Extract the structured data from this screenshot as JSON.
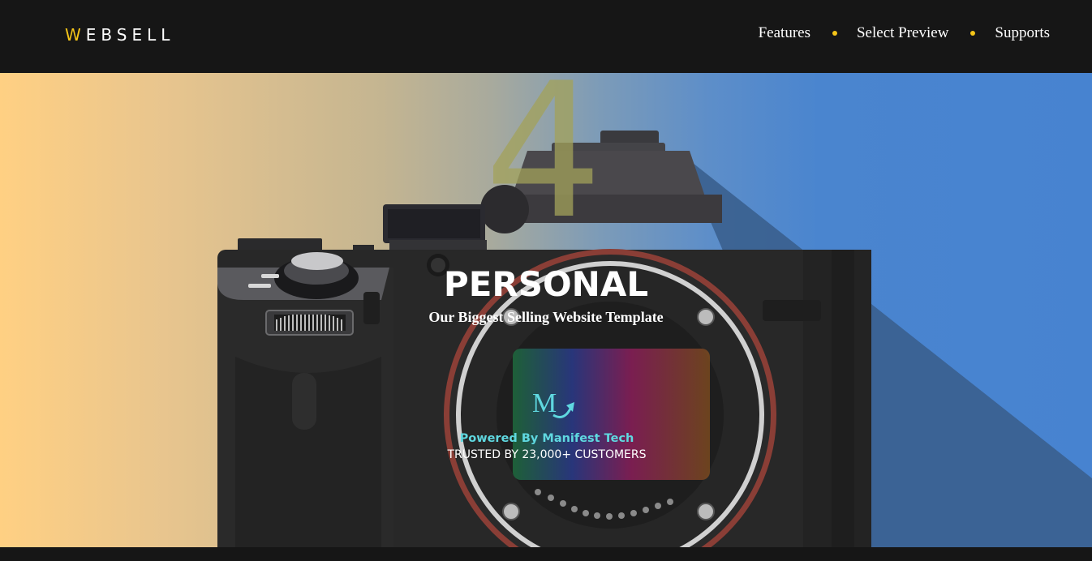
{
  "header": {
    "logo_first": "W",
    "logo_rest": "EBSELL",
    "nav": [
      {
        "label": "Features"
      },
      {
        "label": "Select Preview"
      },
      {
        "label": "Supports"
      }
    ]
  },
  "hero": {
    "big_number": "4",
    "title": "PERSONAL",
    "subtitle": "Our Biggest Selling Website Template",
    "powered": "Powered By Manifest Tech",
    "trusted": "TRUSTED BY 23,000+ CUSTOMERS",
    "badge_letter": "M"
  },
  "colors": {
    "accent": "#f5c518",
    "header_bg": "#161616",
    "powered_text": "#5fd8e0",
    "gradient_left": "#ffd083",
    "gradient_right": "#4783d0"
  }
}
